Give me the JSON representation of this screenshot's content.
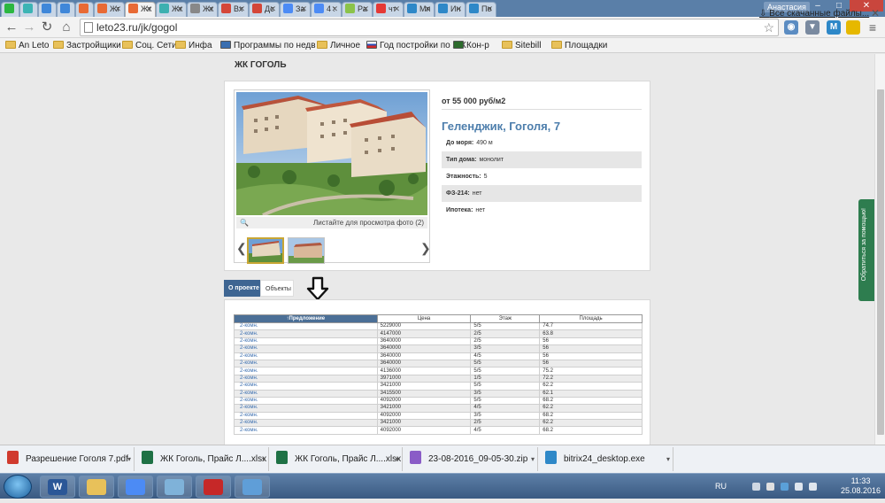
{
  "tabs": [
    {
      "label": "",
      "icon": "whatsapp-icon",
      "color": "#2bb741"
    },
    {
      "label": "",
      "icon": "analytics-icon",
      "color": "#3cb4b4"
    },
    {
      "label": "",
      "icon": "avito-icon",
      "color": "#3f87d9"
    },
    {
      "label": "",
      "icon": "avito-icon",
      "color": "#3f87d9"
    },
    {
      "label": "",
      "icon": "home-icon",
      "color": "#e86a35"
    },
    {
      "label": "Жг",
      "icon": "s-icon",
      "color": "#e86a35"
    },
    {
      "label": "Жк",
      "icon": "home-icon",
      "color": "#e86a35",
      "active": true
    },
    {
      "label": "Жк",
      "icon": "app-icon",
      "color": "#3cb0b0"
    },
    {
      "label": "Жк",
      "icon": "doc-icon",
      "color": "#888888"
    },
    {
      "label": "Вх",
      "icon": "gmail-icon",
      "color": "#d44638"
    },
    {
      "label": "Дс",
      "icon": "gmail-icon",
      "color": "#d44638"
    },
    {
      "label": "За",
      "icon": "search-icon",
      "color": "#4c8bf5"
    },
    {
      "label": "4 :",
      "icon": "chat-icon",
      "color": "#4c8bf5"
    },
    {
      "label": "Ра",
      "icon": "rainbow-icon",
      "color": "#8bc34a"
    },
    {
      "label": "чт",
      "icon": "yandex-icon",
      "color": "#e53935"
    },
    {
      "label": "Мя",
      "icon": "24-icon",
      "color": "#2e88c8"
    },
    {
      "label": "Ин",
      "icon": "cloud-icon",
      "color": "#2e88c8"
    },
    {
      "label": "По",
      "icon": "24-icon",
      "color": "#2e88c8"
    }
  ],
  "user_name": "Анастасия",
  "address_bar": {
    "url": "leto23.ru/jk/gogol"
  },
  "bookmarks": [
    {
      "label": "An Leto",
      "icon": "folder"
    },
    {
      "label": "Застройщики",
      "icon": "folder"
    },
    {
      "label": "Соц. Сети",
      "icon": "folder"
    },
    {
      "label": "Инфа",
      "icon": "folder"
    },
    {
      "label": "Программы по недв",
      "icon": "grid-icon"
    },
    {
      "label": "Личное",
      "icon": "folder"
    },
    {
      "label": "Год постройки по ЖК",
      "icon": "flag-ru-icon"
    },
    {
      "label": "Кон-р",
      "icon": "k-icon"
    },
    {
      "label": "Sitebill",
      "icon": "folder"
    },
    {
      "label": "Площадки",
      "icon": "folder"
    }
  ],
  "page": {
    "title": "ЖК ГОГОЛЬ",
    "price": "от 55 000 руб/м2",
    "address": "Геленджик, Гоголя, 7",
    "photo_hint": "Листайте для просмотра фото (2)",
    "props": [
      {
        "label": "До моря:",
        "value": "490 м"
      },
      {
        "label": "Тип дома:",
        "value": "монолит"
      },
      {
        "label": "Этажность:",
        "value": "5"
      },
      {
        "label": "ФЗ-214:",
        "value": "нет"
      },
      {
        "label": "Ипотека:",
        "value": "нет"
      }
    ],
    "tabs": [
      "О проекте",
      "Объекты"
    ],
    "help_widget": "Обратиться за помощью!"
  },
  "offers_table": {
    "columns": [
      "↑Предложение",
      "Цена",
      "Этаж",
      "Площадь"
    ],
    "rows": [
      [
        "2-комн.",
        "5229000",
        "5/5",
        "74.7"
      ],
      [
        "2-комн.",
        "4147000",
        "2/5",
        "63.8"
      ],
      [
        "2-комн.",
        "3640000",
        "2/5",
        "56"
      ],
      [
        "2-комн.",
        "3640000",
        "3/5",
        "56"
      ],
      [
        "2-комн.",
        "3640000",
        "4/5",
        "56"
      ],
      [
        "2-комн.",
        "3640000",
        "5/5",
        "56"
      ],
      [
        "2-комн.",
        "4136000",
        "5/5",
        "75.2"
      ],
      [
        "2-комн.",
        "3971000",
        "1/5",
        "72.2"
      ],
      [
        "2-комн.",
        "3421000",
        "5/5",
        "62.2"
      ],
      [
        "2-комн.",
        "3415500",
        "3/5",
        "62.1"
      ],
      [
        "2-комн.",
        "4092000",
        "5/5",
        "68.2"
      ],
      [
        "2-комн.",
        "3421000",
        "4/5",
        "62.2"
      ],
      [
        "2-комн.",
        "4092000",
        "3/5",
        "68.2"
      ],
      [
        "2-комн.",
        "3421000",
        "2/5",
        "62.2"
      ],
      [
        "2-комн.",
        "4092000",
        "4/5",
        "68.2"
      ]
    ]
  },
  "downloads": [
    {
      "label": "Разрешение Гоголя 7.pdf",
      "icon": "pdf-icon",
      "color": "#d03a2e"
    },
    {
      "label": "ЖК Гоголь, Прайс Л....xlsx",
      "icon": "xlsx-icon",
      "color": "#1e7145"
    },
    {
      "label": "ЖК Гоголь, Прайс Л....xlsx",
      "icon": "xlsx-icon",
      "color": "#1e7145"
    },
    {
      "label": "23-08-2016_09-05-30.zip",
      "icon": "zip-icon",
      "color": "#8a5cc7"
    },
    {
      "label": "bitrix24_desktop.exe",
      "icon": "exe-icon",
      "color": "#2e88c8"
    }
  ],
  "downloads_all": "Все скачанные файлы...",
  "taskbar": {
    "apps": [
      {
        "label": "W",
        "icon": "word-icon",
        "color": "#2b5797"
      },
      {
        "label": "",
        "icon": "explorer-icon",
        "color": "#e8c15a"
      },
      {
        "label": "",
        "icon": "chrome-icon",
        "color": "#4c8bf5"
      },
      {
        "label": "",
        "icon": "notes-icon",
        "color": "#7fb2d9"
      },
      {
        "label": "",
        "icon": "acrobat-icon",
        "color": "#c62828"
      },
      {
        "label": "",
        "icon": "paint-icon",
        "color": "#5f9ed8"
      }
    ],
    "lang": "RU",
    "time": "11:33",
    "date": "25.08.2016"
  }
}
